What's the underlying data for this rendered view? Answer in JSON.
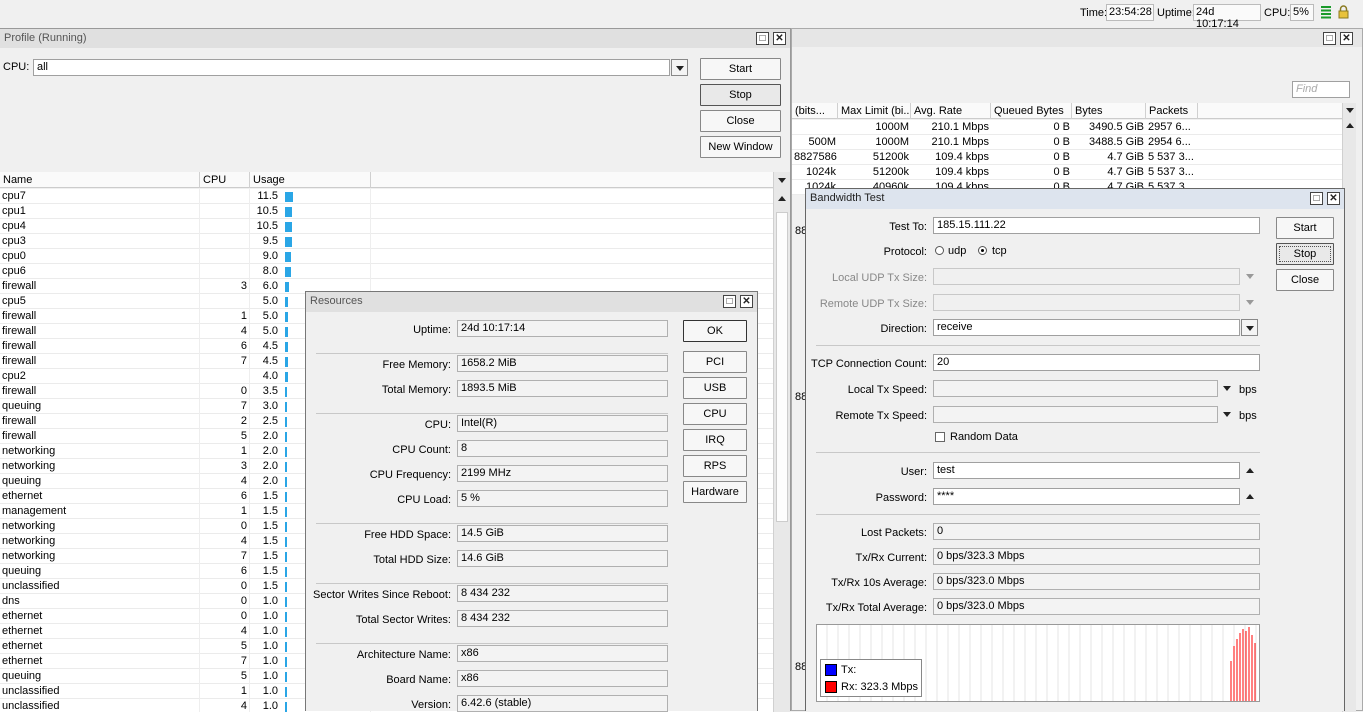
{
  "topbar": {
    "time_label": "Time:",
    "time": "23:54:28",
    "uptime_label": "Uptime:",
    "uptime": "24d 10:17:14",
    "cpu_label": "CPU:",
    "cpu": "5%"
  },
  "profile": {
    "title": "Profile (Running)",
    "cpu_label": "CPU:",
    "cpu_value": "all",
    "buttons": {
      "start": "Start",
      "stop": "Stop",
      "close": "Close",
      "new_window": "New Window"
    },
    "columns": [
      "Name",
      "CPU",
      "Usage"
    ],
    "rows": [
      {
        "name": "cpu7",
        "cpu": "",
        "usage": "11.5"
      },
      {
        "name": "cpu1",
        "cpu": "",
        "usage": "10.5"
      },
      {
        "name": "cpu4",
        "cpu": "",
        "usage": "10.5"
      },
      {
        "name": "cpu3",
        "cpu": "",
        "usage": "9.5"
      },
      {
        "name": "cpu0",
        "cpu": "",
        "usage": "9.0"
      },
      {
        "name": "cpu6",
        "cpu": "",
        "usage": "8.0"
      },
      {
        "name": "firewall",
        "cpu": "3",
        "usage": "6.0"
      },
      {
        "name": "cpu5",
        "cpu": "",
        "usage": "5.0"
      },
      {
        "name": "firewall",
        "cpu": "1",
        "usage": "5.0"
      },
      {
        "name": "firewall",
        "cpu": "4",
        "usage": "5.0"
      },
      {
        "name": "firewall",
        "cpu": "6",
        "usage": "4.5"
      },
      {
        "name": "firewall",
        "cpu": "7",
        "usage": "4.5"
      },
      {
        "name": "cpu2",
        "cpu": "",
        "usage": "4.0"
      },
      {
        "name": "firewall",
        "cpu": "0",
        "usage": "3.5"
      },
      {
        "name": "queuing",
        "cpu": "7",
        "usage": "3.0"
      },
      {
        "name": "firewall",
        "cpu": "2",
        "usage": "2.5"
      },
      {
        "name": "firewall",
        "cpu": "5",
        "usage": "2.0"
      },
      {
        "name": "networking",
        "cpu": "1",
        "usage": "2.0"
      },
      {
        "name": "networking",
        "cpu": "3",
        "usage": "2.0"
      },
      {
        "name": "queuing",
        "cpu": "4",
        "usage": "2.0"
      },
      {
        "name": "ethernet",
        "cpu": "6",
        "usage": "1.5"
      },
      {
        "name": "management",
        "cpu": "1",
        "usage": "1.5"
      },
      {
        "name": "networking",
        "cpu": "0",
        "usage": "1.5"
      },
      {
        "name": "networking",
        "cpu": "4",
        "usage": "1.5"
      },
      {
        "name": "networking",
        "cpu": "7",
        "usage": "1.5"
      },
      {
        "name": "queuing",
        "cpu": "6",
        "usage": "1.5"
      },
      {
        "name": "unclassified",
        "cpu": "0",
        "usage": "1.5"
      },
      {
        "name": "dns",
        "cpu": "0",
        "usage": "1.0"
      },
      {
        "name": "ethernet",
        "cpu": "0",
        "usage": "1.0"
      },
      {
        "name": "ethernet",
        "cpu": "4",
        "usage": "1.0"
      },
      {
        "name": "ethernet",
        "cpu": "5",
        "usage": "1.0"
      },
      {
        "name": "ethernet",
        "cpu": "7",
        "usage": "1.0"
      },
      {
        "name": "queuing",
        "cpu": "5",
        "usage": "1.0"
      },
      {
        "name": "unclassified",
        "cpu": "1",
        "usage": "1.0"
      },
      {
        "name": "unclassified",
        "cpu": "4",
        "usage": "1.0"
      }
    ]
  },
  "queues": {
    "find_placeholder": "Find",
    "columns": [
      "(bits...",
      "Max Limit (bi...",
      "Avg. Rate",
      "Queued Bytes",
      "Bytes",
      "Packets"
    ],
    "rows": [
      [
        "",
        "1000M",
        "210.1 Mbps",
        "0 B",
        "3490.5 GiB",
        "2957 6..."
      ],
      [
        "500M",
        "1000M",
        "210.1 Mbps",
        "0 B",
        "3488.5 GiB",
        "2954 6..."
      ],
      [
        "8827586",
        "51200k",
        "109.4 kbps",
        "0 B",
        "4.7 GiB",
        "5 537 3..."
      ],
      [
        "1024k",
        "51200k",
        "109.4 kbps",
        "0 B",
        "4.7 GiB",
        "5 537 3..."
      ],
      [
        "1024k",
        "40960k",
        "109.4 kbps",
        "0 B",
        "4.7 GiB",
        "5 537 3..."
      ]
    ],
    "side_labels": [
      "88",
      "88",
      "88"
    ]
  },
  "resources": {
    "title": "Resources",
    "fields": [
      {
        "label": "Uptime:",
        "value": "24d 10:17:14"
      },
      {
        "label": "Free Memory:",
        "value": "1658.2 MiB"
      },
      {
        "label": "Total Memory:",
        "value": "1893.5 MiB"
      },
      {
        "label": "CPU:",
        "value": "Intel(R)"
      },
      {
        "label": "CPU Count:",
        "value": "8"
      },
      {
        "label": "CPU Frequency:",
        "value": "2199 MHz"
      },
      {
        "label": "CPU Load:",
        "value": "5 %"
      },
      {
        "label": "Free HDD Space:",
        "value": "14.5 GiB"
      },
      {
        "label": "Total HDD Size:",
        "value": "14.6 GiB"
      },
      {
        "label": "Sector Writes Since Reboot:",
        "value": "8 434 232"
      },
      {
        "label": "Total Sector Writes:",
        "value": "8 434 232"
      },
      {
        "label": "Architecture Name:",
        "value": "x86"
      },
      {
        "label": "Board Name:",
        "value": "x86"
      },
      {
        "label": "Version:",
        "value": "6.42.6 (stable)"
      }
    ],
    "buttons": [
      "OK",
      "PCI",
      "USB",
      "CPU",
      "IRQ",
      "RPS",
      "Hardware"
    ]
  },
  "bwtest": {
    "title": "Bandwidth Test",
    "test_to_label": "Test To:",
    "test_to": "185.15.111.22",
    "protocol_label": "Protocol:",
    "udp": "udp",
    "tcp": "tcp",
    "local_udp_label": "Local UDP Tx Size:",
    "remote_udp_label": "Remote UDP Tx Size:",
    "direction_label": "Direction:",
    "direction": "receive",
    "tcp_count_label": "TCP Connection Count:",
    "tcp_count": "20",
    "local_speed_label": "Local Tx Speed:",
    "remote_speed_label": "Remote Tx Speed:",
    "bps": "bps",
    "random_data": "Random Data",
    "user_label": "User:",
    "user": "test",
    "password_label": "Password:",
    "password": "****",
    "lost_label": "Lost Packets:",
    "lost": "0",
    "current_label": "Tx/Rx Current:",
    "current": "0 bps/323.3 Mbps",
    "avg10_label": "Tx/Rx 10s Average:",
    "avg10": "0 bps/323.0 Mbps",
    "total_label": "Tx/Rx Total Average:",
    "total": "0 bps/323.0 Mbps",
    "buttons": {
      "start": "Start",
      "stop": "Stop",
      "close": "Close"
    },
    "legend": {
      "tx": "Tx:",
      "rx": "Rx:  323.3 Mbps",
      "tx_color": "#0000ff",
      "rx_color": "#ff0000"
    }
  }
}
